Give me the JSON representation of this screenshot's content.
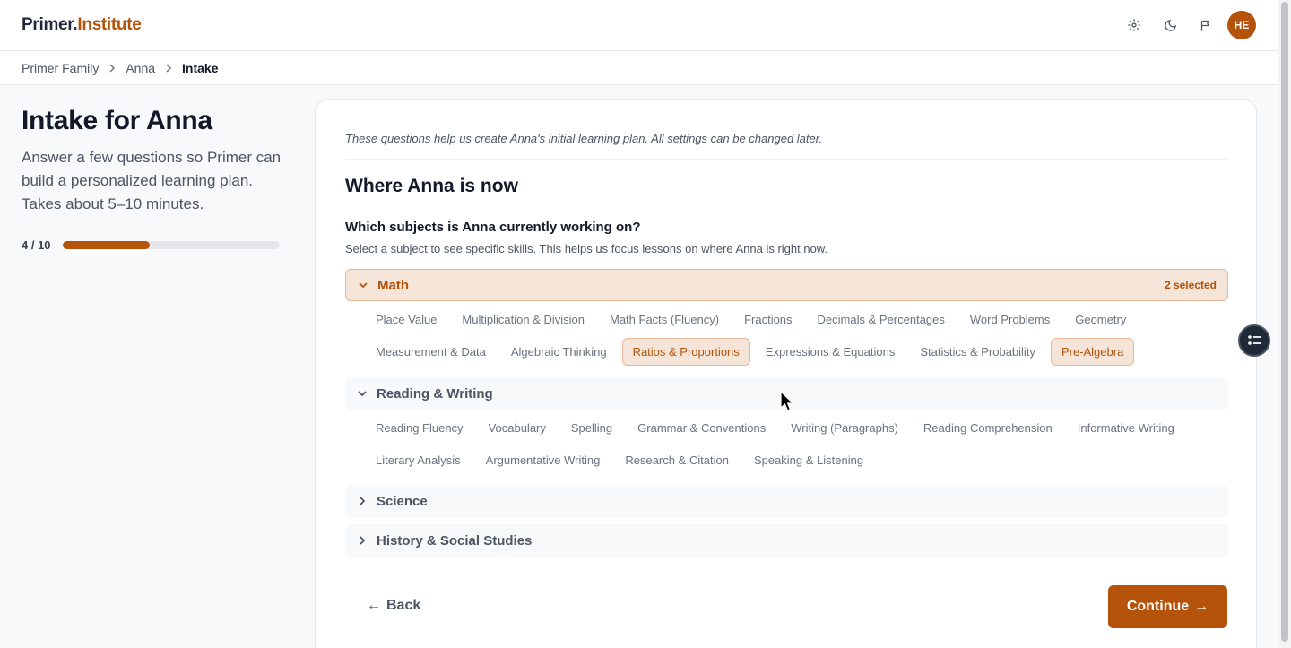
{
  "header": {
    "logo_part1": "Primer.",
    "logo_part2": "Institute",
    "icons": [
      "gear-icon",
      "moon-icon",
      "flag-icon"
    ],
    "avatar_initials": "HE"
  },
  "breadcrumb": {
    "items": [
      "Primer Family",
      "Anna"
    ],
    "current": "Intake"
  },
  "sidebar": {
    "title": "Intake for Anna",
    "description": "Answer a few questions so Primer can build a personalized learning plan. Takes about 5–10 minutes.",
    "progress_label": "4 / 10",
    "progress_fraction": 0.4
  },
  "main": {
    "intro": "These questions help us create Anna's initial learning plan. All settings can be changed later.",
    "section_title": "Where Anna is now",
    "question": "Which subjects is Anna currently working on?",
    "helptext": "Select a subject to see specific skills. This helps us focus lessons on where Anna is right now.",
    "subjects": [
      {
        "name": "Math",
        "expanded": true,
        "selected_count": "2 selected",
        "skills_row1": [
          "Place Value",
          "Multiplication & Division",
          "Math Facts (Fluency)",
          "Fractions",
          "Decimals & Percentages",
          "Word Problems",
          "Geometry"
        ],
        "skills_row2": [
          "Measurement & Data",
          "Algebraic Thinking",
          "Ratios & Proportions",
          "Expressions & Equations",
          "Statistics & Probability",
          "Pre-Algebra"
        ],
        "selected": [
          "Ratios & Proportions",
          "Pre-Algebra"
        ]
      },
      {
        "name": "Reading & Writing",
        "expanded": true,
        "skills_row1": [
          "Reading Fluency",
          "Vocabulary",
          "Spelling",
          "Grammar & Conventions",
          "Writing (Paragraphs)",
          "Reading Comprehension",
          "Informative Writing"
        ],
        "skills_row2": [
          "Literary Analysis",
          "Argumentative Writing",
          "Research & Citation",
          "Speaking & Listening"
        ]
      },
      {
        "name": "Science",
        "expanded": false
      },
      {
        "name": "History & Social Studies",
        "expanded": false
      }
    ],
    "back_label": "Back",
    "continue_label": "Continue"
  },
  "colors": {
    "accent": "#b45309",
    "accent_bg": "#f5e4d8",
    "text": "#111827",
    "muted": "#4b5563"
  }
}
